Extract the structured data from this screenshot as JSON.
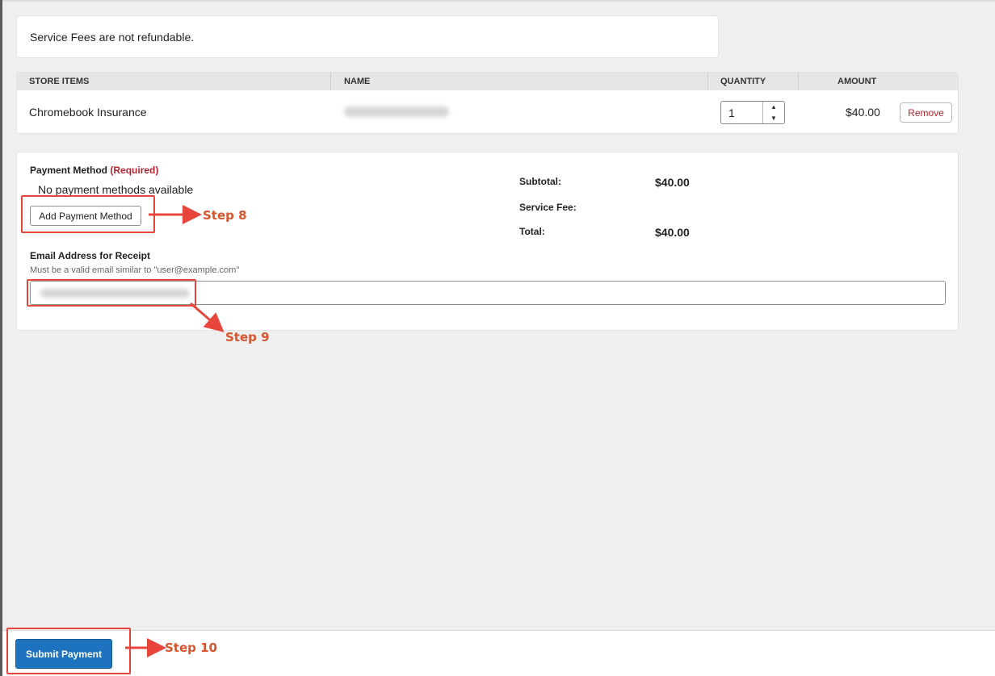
{
  "notice": {
    "text": "Service Fees are not refundable."
  },
  "store_items": {
    "headers": {
      "store_items": "STORE ITEMS",
      "name": "NAME",
      "quantity": "QUANTITY",
      "amount": "AMOUNT"
    },
    "rows": [
      {
        "item": "Chromebook Insurance",
        "quantity": "1",
        "amount": "$40.00",
        "remove_label": "Remove"
      }
    ]
  },
  "payment": {
    "method_label": "Payment Method",
    "required_label": "(Required)",
    "no_methods_text": "No payment methods available",
    "add_button_label": "Add Payment Method",
    "summary": {
      "subtotal_label": "Subtotal:",
      "subtotal_value": "$40.00",
      "service_fee_label": "Service Fee:",
      "service_fee_value": "",
      "total_label": "Total:",
      "total_value": "$40.00"
    },
    "email_label": "Email Address for Receipt",
    "email_hint": "Must be a valid email similar to \"user@example.com\""
  },
  "footer": {
    "submit_label": "Submit Payment"
  },
  "annotations": {
    "step8": "Step 8",
    "step9": "Step 9",
    "step10": "Step 10",
    "color": "#e8453c"
  },
  "colors": {
    "primary": "#1e73be",
    "danger": "#b4232e",
    "background": "#efefef"
  }
}
